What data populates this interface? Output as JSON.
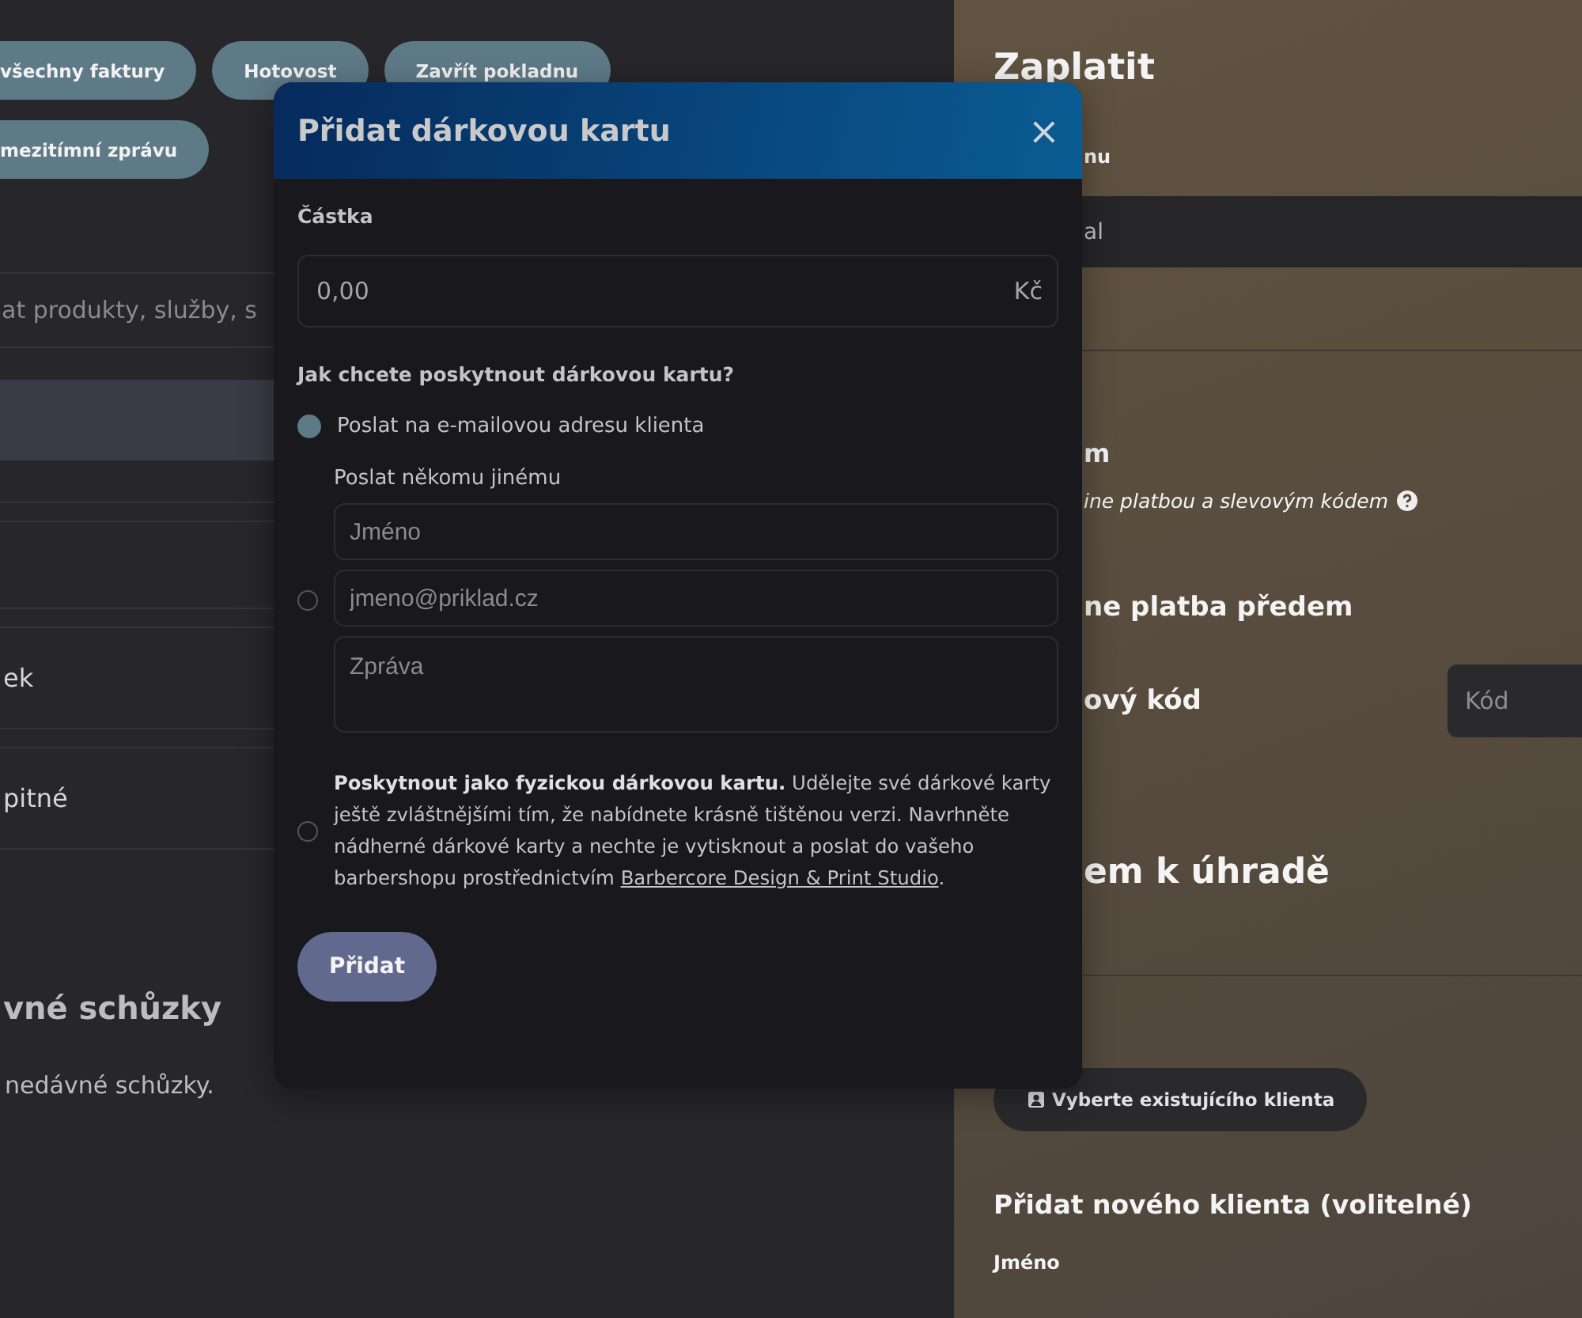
{
  "left_panel": {
    "action_rows": [
      [
        "všechny faktury",
        "Hotovost",
        "Zavřít pokladnu"
      ],
      [
        "mezitímní zprávu"
      ]
    ],
    "search": {
      "placeholder": "at produkty, služby, s"
    },
    "list_items": [
      {
        "selected": true
      },
      {
        "selected": false
      },
      {
        "selected": false
      },
      {
        "label": "ek",
        "selected": false
      },
      {
        "label": "pitné",
        "selected": false
      }
    ],
    "recent": {
      "heading": "vné schůzky",
      "empty_text": "nedávné schůzky."
    }
  },
  "payment_panel": {
    "title": "Zaplatit",
    "label": "nu",
    "field_value": "al",
    "section_heading": "m",
    "section_hint": "ine platbou a slevovým kódem",
    "prepayment_heading": "ne platba předem",
    "discount_label": "ový kód",
    "discount_placeholder": "Kód",
    "due_heading": "em k úhradě",
    "select_client_button": "Vyberte existujícího klienta",
    "new_client_heading": "Přidat nového klienta (volitelné)",
    "name_label": "Jméno"
  },
  "dialog": {
    "title": "Přidat dárkovou kartu",
    "close": "×",
    "amount_label": "Částka",
    "amount_value": "0,00",
    "currency": "Kč",
    "question": "Jak chcete poskytnout dárkovou kartu?",
    "options": [
      {
        "kind": "email",
        "selected": true,
        "label": "Poslat na e-mailovou adresu klienta"
      },
      {
        "kind": "other",
        "selected": false,
        "label": "Poslat někomu jinému",
        "fields": [
          {
            "kind": "input",
            "placeholder": "Jméno"
          },
          {
            "kind": "input",
            "placeholder": "jmeno@priklad.cz"
          },
          {
            "kind": "textarea",
            "placeholder": "Zpráva"
          }
        ]
      },
      {
        "kind": "physical",
        "selected": false,
        "text": "**Poskytnout jako fyzickou dárkovou kartu.** Udělejte své dárkové karty ještě zvláštnějšími tím, že nabídnete krásně tištěnou verzi. Navrhněte nádherné dárkové karty a nechte je vytisknout a poslat do vašeho barbershopu prostřednictvím",
        "link": "Barbercore Design & Print Studio",
        "text_end": "."
      }
    ],
    "submit": "Přidat"
  }
}
